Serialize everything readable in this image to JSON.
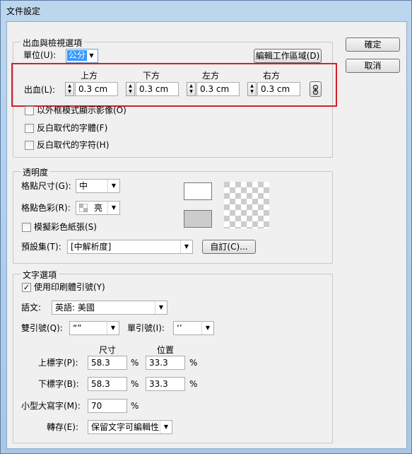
{
  "window": {
    "title": "文件設定"
  },
  "buttons": {
    "ok": "確定",
    "cancel": "取消"
  },
  "bleed": {
    "group_title": "出血與檢視選項",
    "unit_label": "單位(U):",
    "unit_value": "公分",
    "edit_artboard": "編輯工作區域(D)",
    "bleed_label": "出血(L):",
    "headers": {
      "top": "上方",
      "bottom": "下方",
      "left": "左方",
      "right": "右方"
    },
    "values": {
      "top": "0.3 cm",
      "bottom": "0.3 cm",
      "left": "0.3 cm",
      "right": "0.3 cm"
    },
    "options": [
      {
        "label": "以外框模式顯示影像(O)",
        "checked": false
      },
      {
        "label": "反白取代的字體(F)",
        "checked": false
      },
      {
        "label": "反白取代的字符(H)",
        "checked": false
      }
    ]
  },
  "transparency": {
    "group_title": "透明度",
    "grid_size_label": "格點尺寸(G):",
    "grid_size_value": "中",
    "grid_colors_label": "格點色彩(R):",
    "grid_colors_value": "亮",
    "simulate_paper_label": "模擬彩色紙張(S)",
    "simulate_paper_checked": false,
    "preset_label": "預設集(T):",
    "preset_value": "[中解析度]",
    "custom_button": "自訂(C)...",
    "colors": {
      "swatch_top": "#ffffff",
      "swatch_bottom": "#cccccc"
    }
  },
  "type": {
    "group_title": "文字選項",
    "use_typographers_quotes_label": "使用印刷體引號(Y)",
    "use_typographers_quotes_checked": true,
    "language_label": "語文:",
    "language_value": "英語: 美國",
    "double_quotes_label": "雙引號(Q):",
    "double_quotes_value": "“”",
    "single_quotes_label": "單引號(I):",
    "single_quotes_value": "‘’",
    "size_header": "尺寸",
    "position_header": "位置",
    "superscript_label": "上標字(P):",
    "superscript_size": "58.3",
    "superscript_position": "33.3",
    "subscript_label": "下標字(B):",
    "subscript_size": "58.3",
    "subscript_position": "33.3",
    "small_caps_label": "小型大寫字(M):",
    "small_caps_value": "70",
    "percent": "%",
    "export_label": "轉存(E):",
    "export_value": "保留文字可編輯性"
  }
}
